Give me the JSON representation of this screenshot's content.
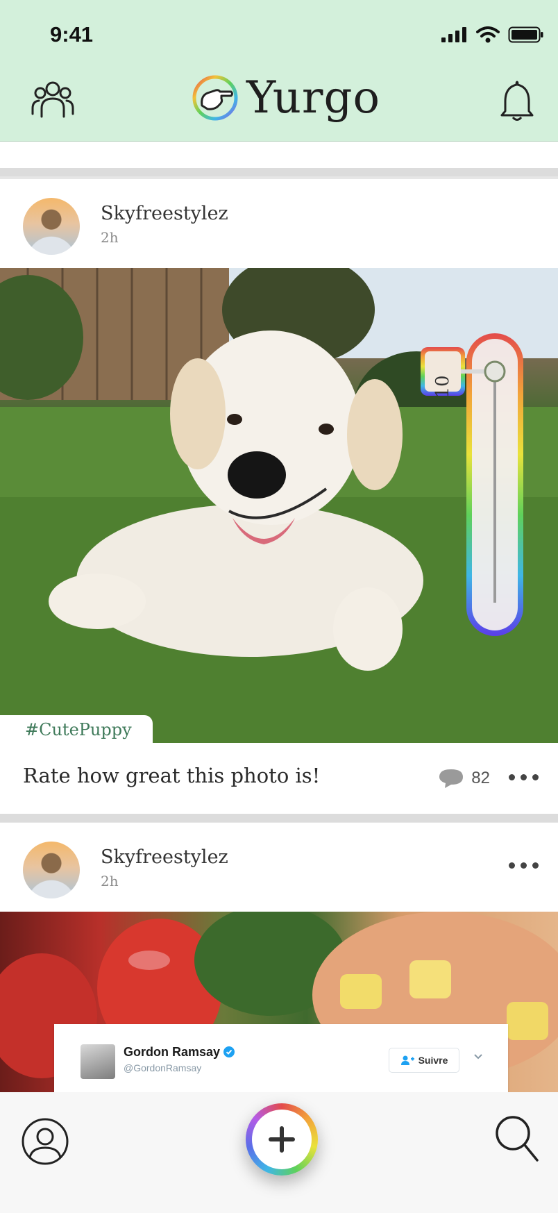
{
  "status_bar": {
    "time": "9:41"
  },
  "header": {
    "app_name": "Yurgo",
    "icons": {
      "left": "friends-icon",
      "right": "bell-icon",
      "logo": "pointing-hand-logo"
    }
  },
  "posts": [
    {
      "username": "Skyfreestylez",
      "time": "2h",
      "hashtag": "#CutePuppy",
      "caption": "Rate how great this photo is!",
      "comments": "82",
      "rating": {
        "value": "10",
        "level": 1.0
      }
    },
    {
      "username": "Skyfreestylez",
      "time": "2h",
      "embedded_tweet": {
        "name": "Gordon Ramsay",
        "handle": "@GordonRamsay",
        "follow_label": "Suivre"
      }
    }
  ],
  "bottom_bar": {
    "icons": {
      "left": "profile-icon",
      "center": "add-icon",
      "right": "search-icon"
    }
  },
  "colors": {
    "header_bg": "#d3f0db",
    "hashtag": "#3f7a5a",
    "text": "#2a2a2a"
  }
}
